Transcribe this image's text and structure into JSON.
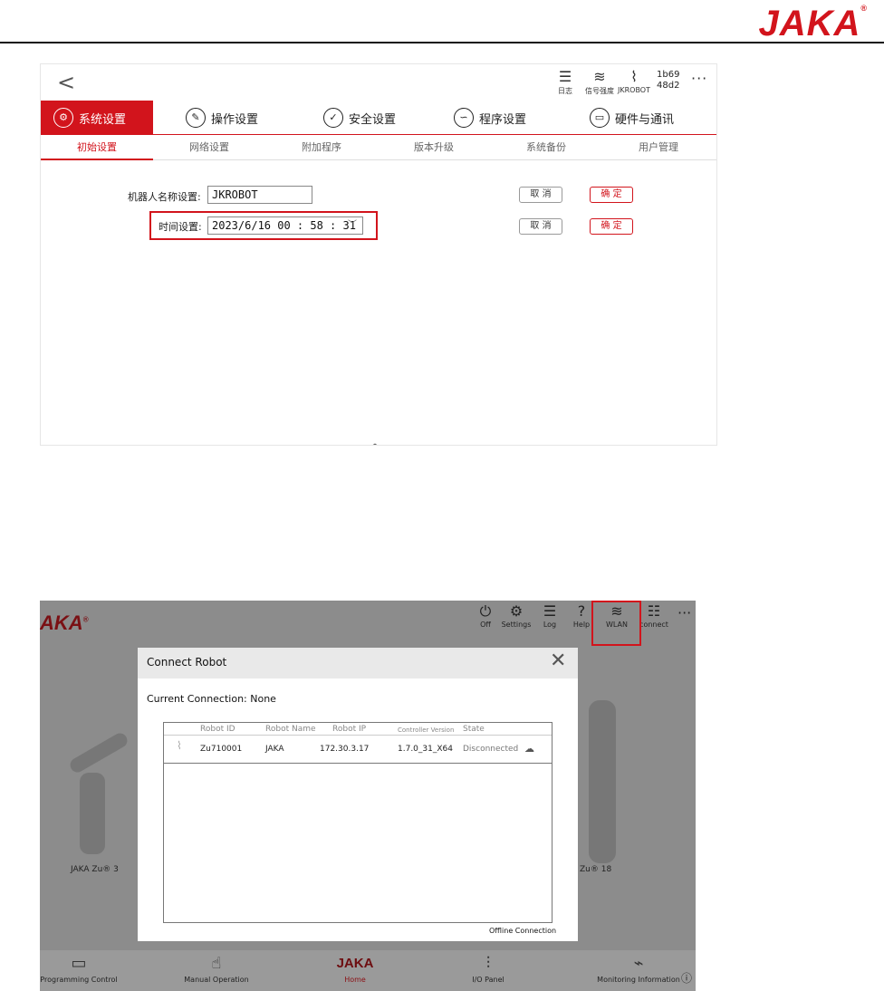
{
  "doc": {
    "logo": "JAKA",
    "logo_mark": "®"
  },
  "shot1": {
    "back": "<",
    "toolbar": [
      {
        "glyph": "☰",
        "label": "日志"
      },
      {
        "glyph": "≋",
        "label": "信号强度"
      },
      {
        "glyph": "⌇",
        "label": "JKROBOT"
      }
    ],
    "version": [
      "1b69",
      "48d2"
    ],
    "more": "···",
    "main_tabs": [
      {
        "icon": "⚙",
        "label": "系统设置",
        "active": true
      },
      {
        "icon": "✎",
        "label": "操作设置"
      },
      {
        "icon": "✓",
        "label": "安全设置"
      },
      {
        "icon": "∽",
        "label": "程序设置"
      },
      {
        "icon": "▭",
        "label": "硬件与通讯"
      }
    ],
    "sub_tabs": [
      "初始设置",
      "网络设置",
      "附加程序",
      "版本升级",
      "系统备份",
      "用户管理"
    ],
    "form": {
      "name_label": "机器人名称设置:",
      "name_value": "JKROBOT",
      "time_label": "时间设置:",
      "time_value": "2023/6/16  00 : 58 : 31",
      "cancel": "取 消",
      "confirm": "确 定"
    },
    "chevron": "︿"
  },
  "shot2": {
    "logo": "AKA",
    "logo_mark": "®",
    "toolbar": [
      {
        "glyph": "⏻",
        "label": "Off"
      },
      {
        "glyph": "⚙",
        "label": "Settings"
      },
      {
        "glyph": "☰",
        "label": "Log"
      },
      {
        "glyph": "?",
        "label": "Help"
      },
      {
        "glyph": "≋",
        "label": "WLAN"
      },
      {
        "glyph": "☷",
        "label": "connect"
      }
    ],
    "more": "···",
    "robots": [
      "JAKA Zu® 3",
      "Zu® 18"
    ],
    "dialog": {
      "title": "Connect Robot",
      "close": "✕",
      "current": "Current Connection: None",
      "headers": [
        "Robot ID",
        "Robot Name",
        "Robot IP",
        "Controller Version",
        "State"
      ],
      "row": [
        "Zu710001",
        "JAKA",
        "172.30.3.17",
        "1.7.0_31_X64",
        "Disconnected"
      ],
      "offline": "Offline Connection"
    },
    "bottom": [
      {
        "glyph": "▭",
        "label": "Programming Control"
      },
      {
        "glyph": "☝",
        "label": "Manual Operation"
      },
      {
        "glyph": "JAKA",
        "label": "Home"
      },
      {
        "glyph": "⫶",
        "label": "I/O Panel"
      },
      {
        "glyph": "⌁",
        "label": "Monitoring Information"
      }
    ],
    "info": "ⓘ"
  },
  "colors": {
    "accent": "#d2141c"
  }
}
